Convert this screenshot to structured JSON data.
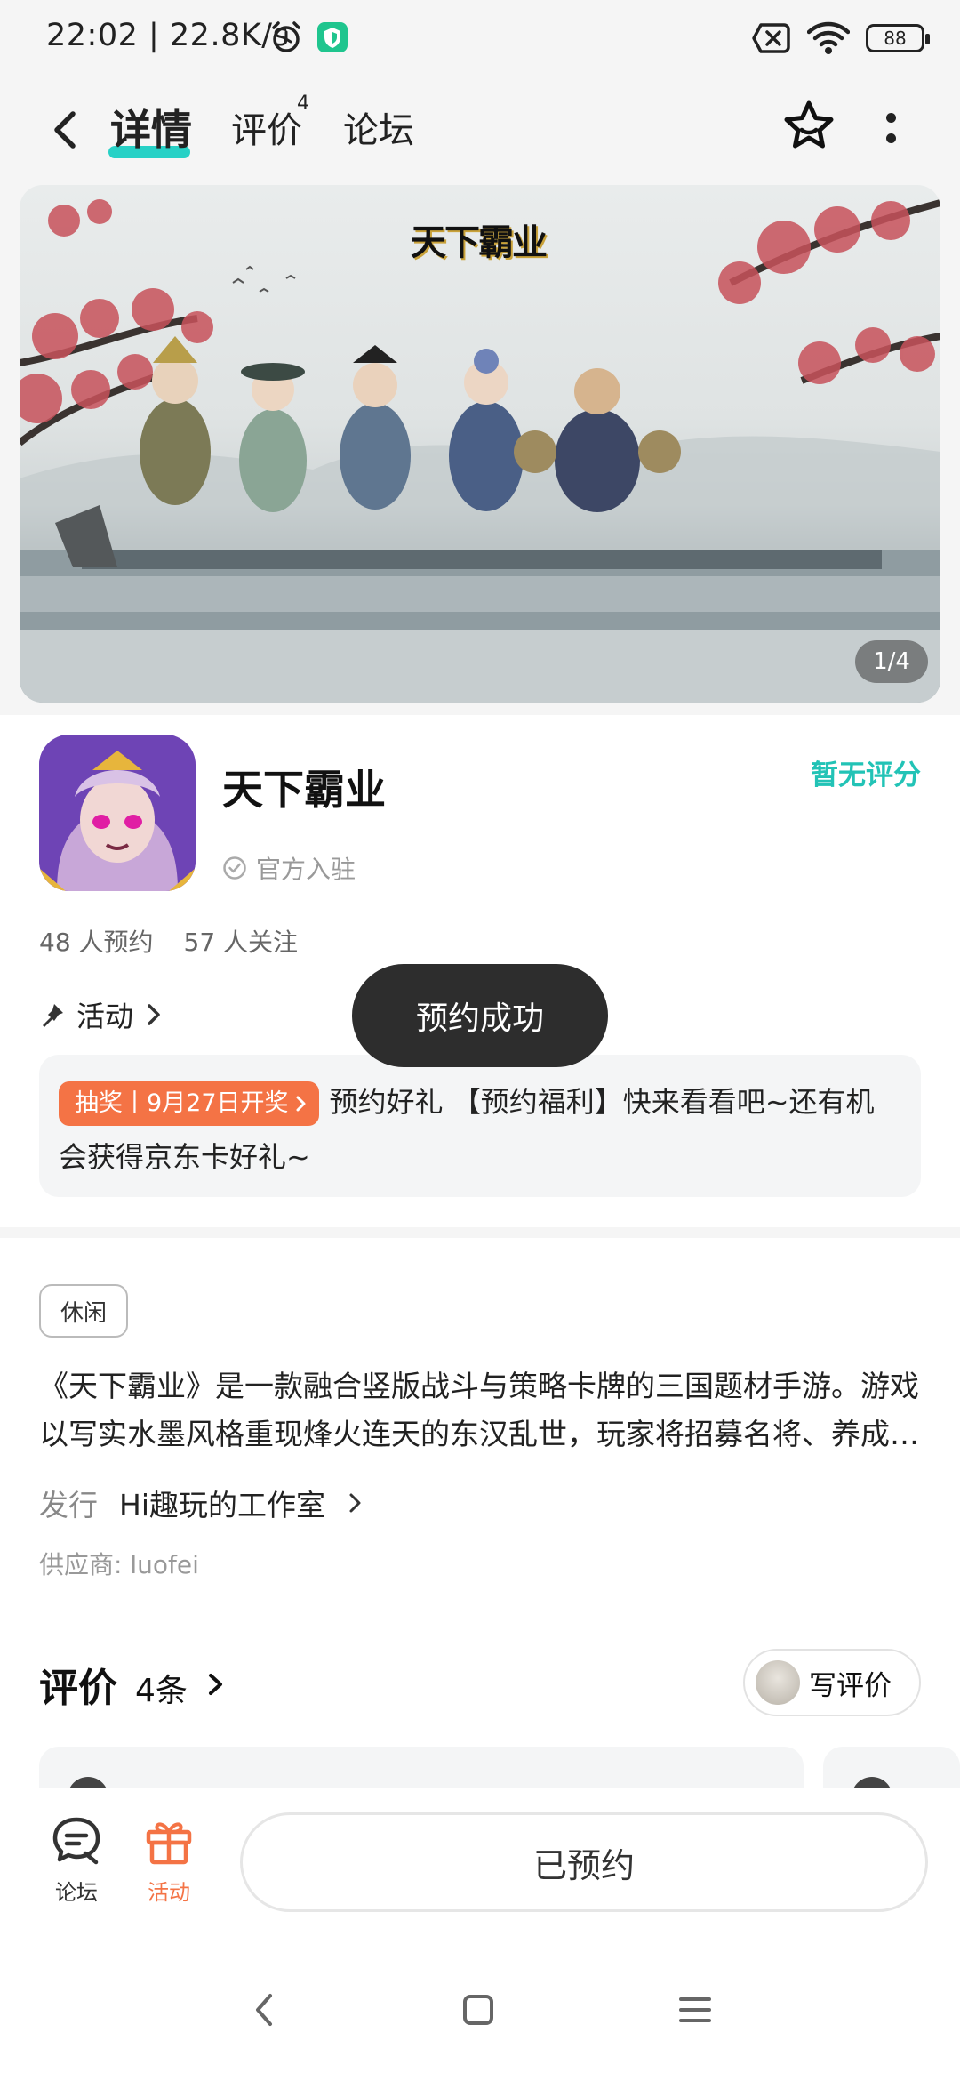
{
  "status_bar": {
    "time_speed": "22:02 | 22.8K/s",
    "battery": "88"
  },
  "header": {
    "tabs": [
      {
        "label": "详情",
        "active": true
      },
      {
        "label": "评价",
        "badge": "4"
      },
      {
        "label": "论坛"
      }
    ]
  },
  "banner": {
    "logo_text": "天下霸业",
    "counter": "1/4"
  },
  "app": {
    "name": "天下霸业",
    "official": "官方入驻",
    "rating": "暂无评分",
    "reservations": "48 人预约",
    "followers": "57 人关注"
  },
  "activity": {
    "section_label": "活动",
    "tag": "抽奖丨9月27日开奖",
    "text": "预约好礼 【预约福利】快来看看吧~还有机会获得京东卡好礼~"
  },
  "toast": "预约成功",
  "details": {
    "genre": "休闲",
    "description_line1": "《天下霸业》是一款融合竖版战斗与策略卡牌的三国题材手游。游戏",
    "description_line2": "以写实水墨风格重现烽火连天的东汉乱世，玩家将招募名将、养成…",
    "publisher_label": "发行",
    "publisher_name": "Hi趣玩的工作室",
    "supplier": "供应商: luofei"
  },
  "reviews": {
    "title": "评价",
    "count": "4条",
    "write_button": "写评价"
  },
  "bottom_bar": {
    "forum_label": "论坛",
    "activity_label": "活动",
    "reserved_button": "已预约"
  },
  "colors": {
    "accent_teal": "#27d1c6",
    "accent_orange": "#f47345",
    "toast_bg": "#2d2d2d"
  }
}
